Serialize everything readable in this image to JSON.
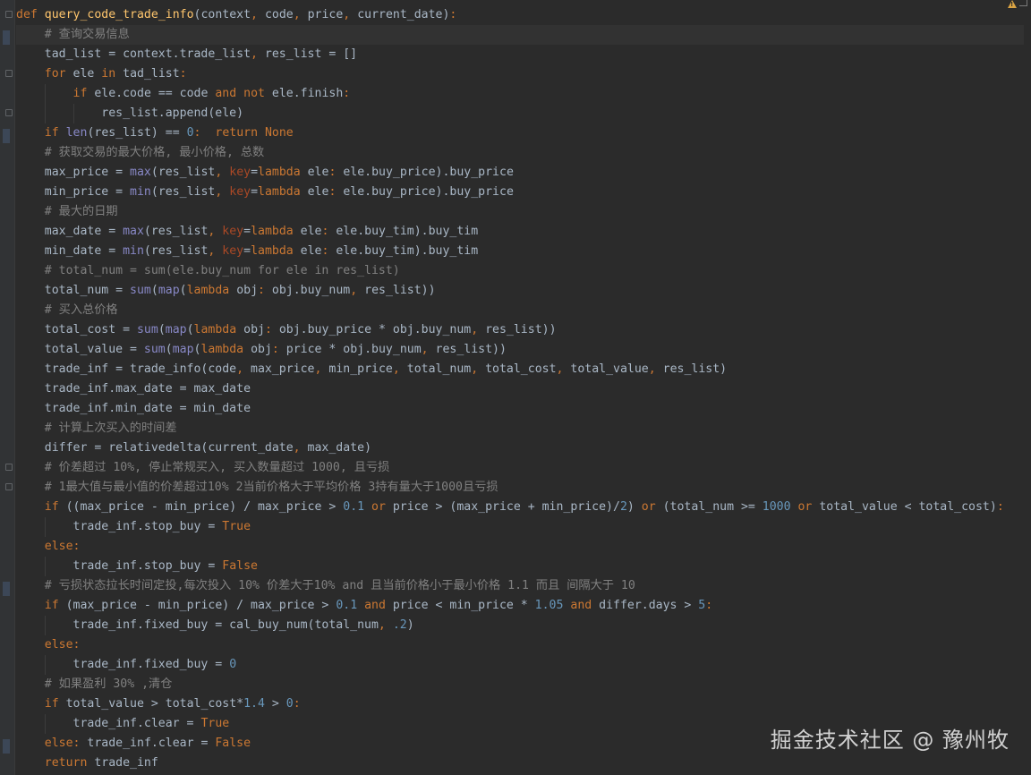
{
  "editor": {
    "language": "python",
    "code_lines": [
      "def query_code_trade_info(context, code, price, current_date):",
      "    # 查询交易信息",
      "    tad_list = context.trade_list, res_list = []",
      "    for ele in tad_list:",
      "        if ele.code == code and not ele.finish:",
      "            res_list.append(ele)",
      "    if len(res_list) == 0:  return None",
      "    # 获取交易的最大价格, 最小价格, 总数",
      "    max_price = max(res_list, key=lambda ele: ele.buy_price).buy_price",
      "    min_price = min(res_list, key=lambda ele: ele.buy_price).buy_price",
      "    # 最大的日期",
      "    max_date = max(res_list, key=lambda ele: ele.buy_tim).buy_tim",
      "    min_date = min(res_list, key=lambda ele: ele.buy_tim).buy_tim",
      "    # total_num = sum(ele.buy_num for ele in res_list)",
      "    total_num = sum(map(lambda obj: obj.buy_num, res_list))",
      "    # 买入总价格",
      "    total_cost = sum(map(lambda obj: obj.buy_price * obj.buy_num, res_list))",
      "    total_value = sum(map(lambda obj: price * obj.buy_num, res_list))",
      "    trade_inf = trade_info(code, max_price, min_price, total_num, total_cost, total_value, res_list)",
      "    trade_inf.max_date = max_date",
      "    trade_inf.min_date = min_date",
      "    # 计算上次买入的时间差",
      "    differ = relativedelta(current_date, max_date)",
      "    # 价差超过 10%, 停止常规买入, 买入数量超过 1000, 且亏损",
      "    # 1最大值与最小值的价差超过10% 2当前价格大于平均价格 3持有量大于1000且亏损",
      "    if ((max_price - min_price) / max_price > 0.1 or price > (max_price + min_price)/2) or (total_num >= 1000 or total_value < total_cost):",
      "        trade_inf.stop_buy = True",
      "    else:",
      "        trade_inf.stop_buy = False",
      "    # 亏损状态拉长时间定投,每次投入 10% 价差大于10% and 且当前价格小于最小价格 1.1 而且 间隔大于 10",
      "    if (max_price - min_price) / max_price > 0.1 and price < min_price * 1.05 and differ.days > 5:",
      "        trade_inf.fixed_buy = cal_buy_num(total_num, .2)",
      "    else:",
      "        trade_inf.fixed_buy = 0",
      "    # 如果盈利 30% ,清仓",
      "    if total_value > total_cost*1.4 > 0:",
      "        trade_inf.clear = True",
      "    else: trade_inf.clear = False",
      "    return trade_inf"
    ],
    "caret_line": 2
  },
  "watermark": {
    "text": "掘金技术社区 @ 豫州牧"
  },
  "colors": {
    "background": "#2b2b2b",
    "default_text": "#a9b7c6",
    "keyword": "#cc7832",
    "function_def": "#ffc66d",
    "builtin": "#8888c6",
    "number": "#6897bb",
    "comment": "#808080",
    "keyword_argument": "#aa4926"
  },
  "icons": {
    "warning": "warning-icon",
    "fold_marker": "fold-icon",
    "breakpoint": "bookmark-icon"
  }
}
